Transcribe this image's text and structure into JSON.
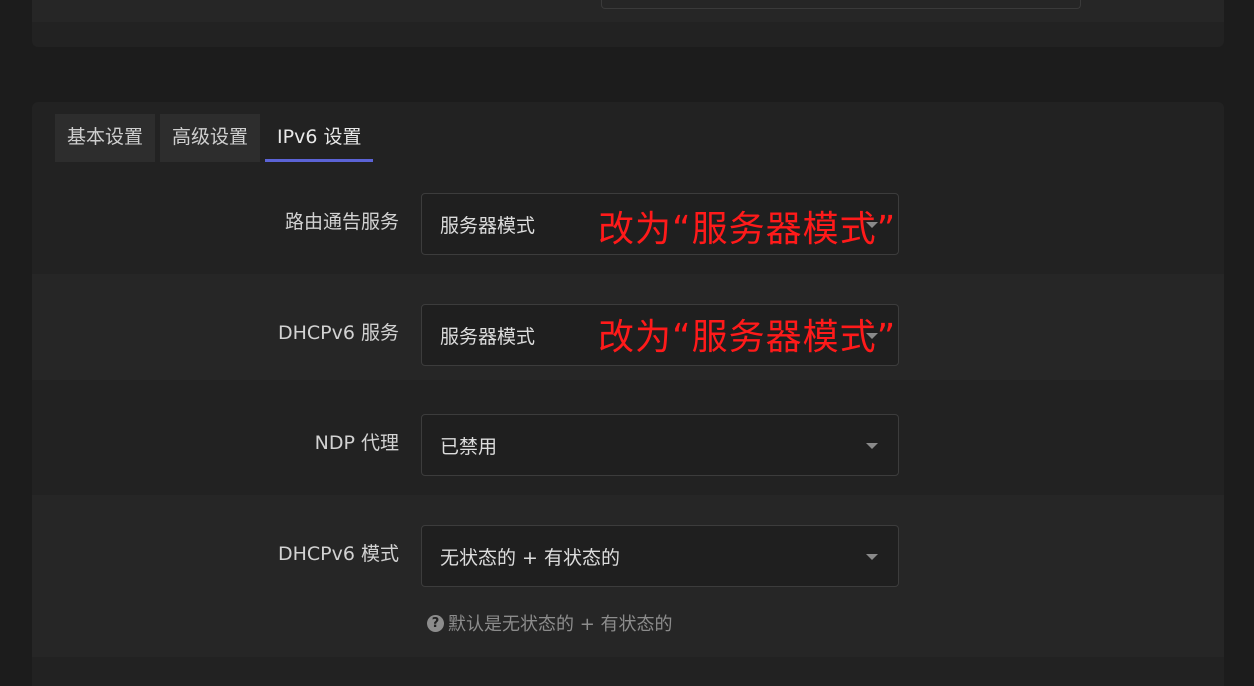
{
  "tabs": [
    {
      "label": "基本设置"
    },
    {
      "label": "高级设置"
    },
    {
      "label": "IPv6 设置"
    }
  ],
  "fields": {
    "router_advert": {
      "label": "路由通告服务",
      "value": "服务器模式"
    },
    "dhcpv6_service": {
      "label": "DHCPv6 服务",
      "value": "服务器模式"
    },
    "ndp_proxy": {
      "label": "NDP 代理",
      "value": "已禁用"
    },
    "dhcpv6_mode": {
      "label": "DHCPv6 模式",
      "value": "无状态的 + 有状态的",
      "hint": "默认是无状态的 + 有状态的"
    }
  },
  "annotations": {
    "router_advert_note": "改为“服务器模式”",
    "dhcpv6_service_note": "改为“服务器模式”"
  },
  "icons": {
    "hint": "question-circle-icon",
    "dropdown": "caret-down-icon"
  },
  "colors": {
    "accent": "#5b63d6",
    "annotation": "#ff1a1a"
  }
}
